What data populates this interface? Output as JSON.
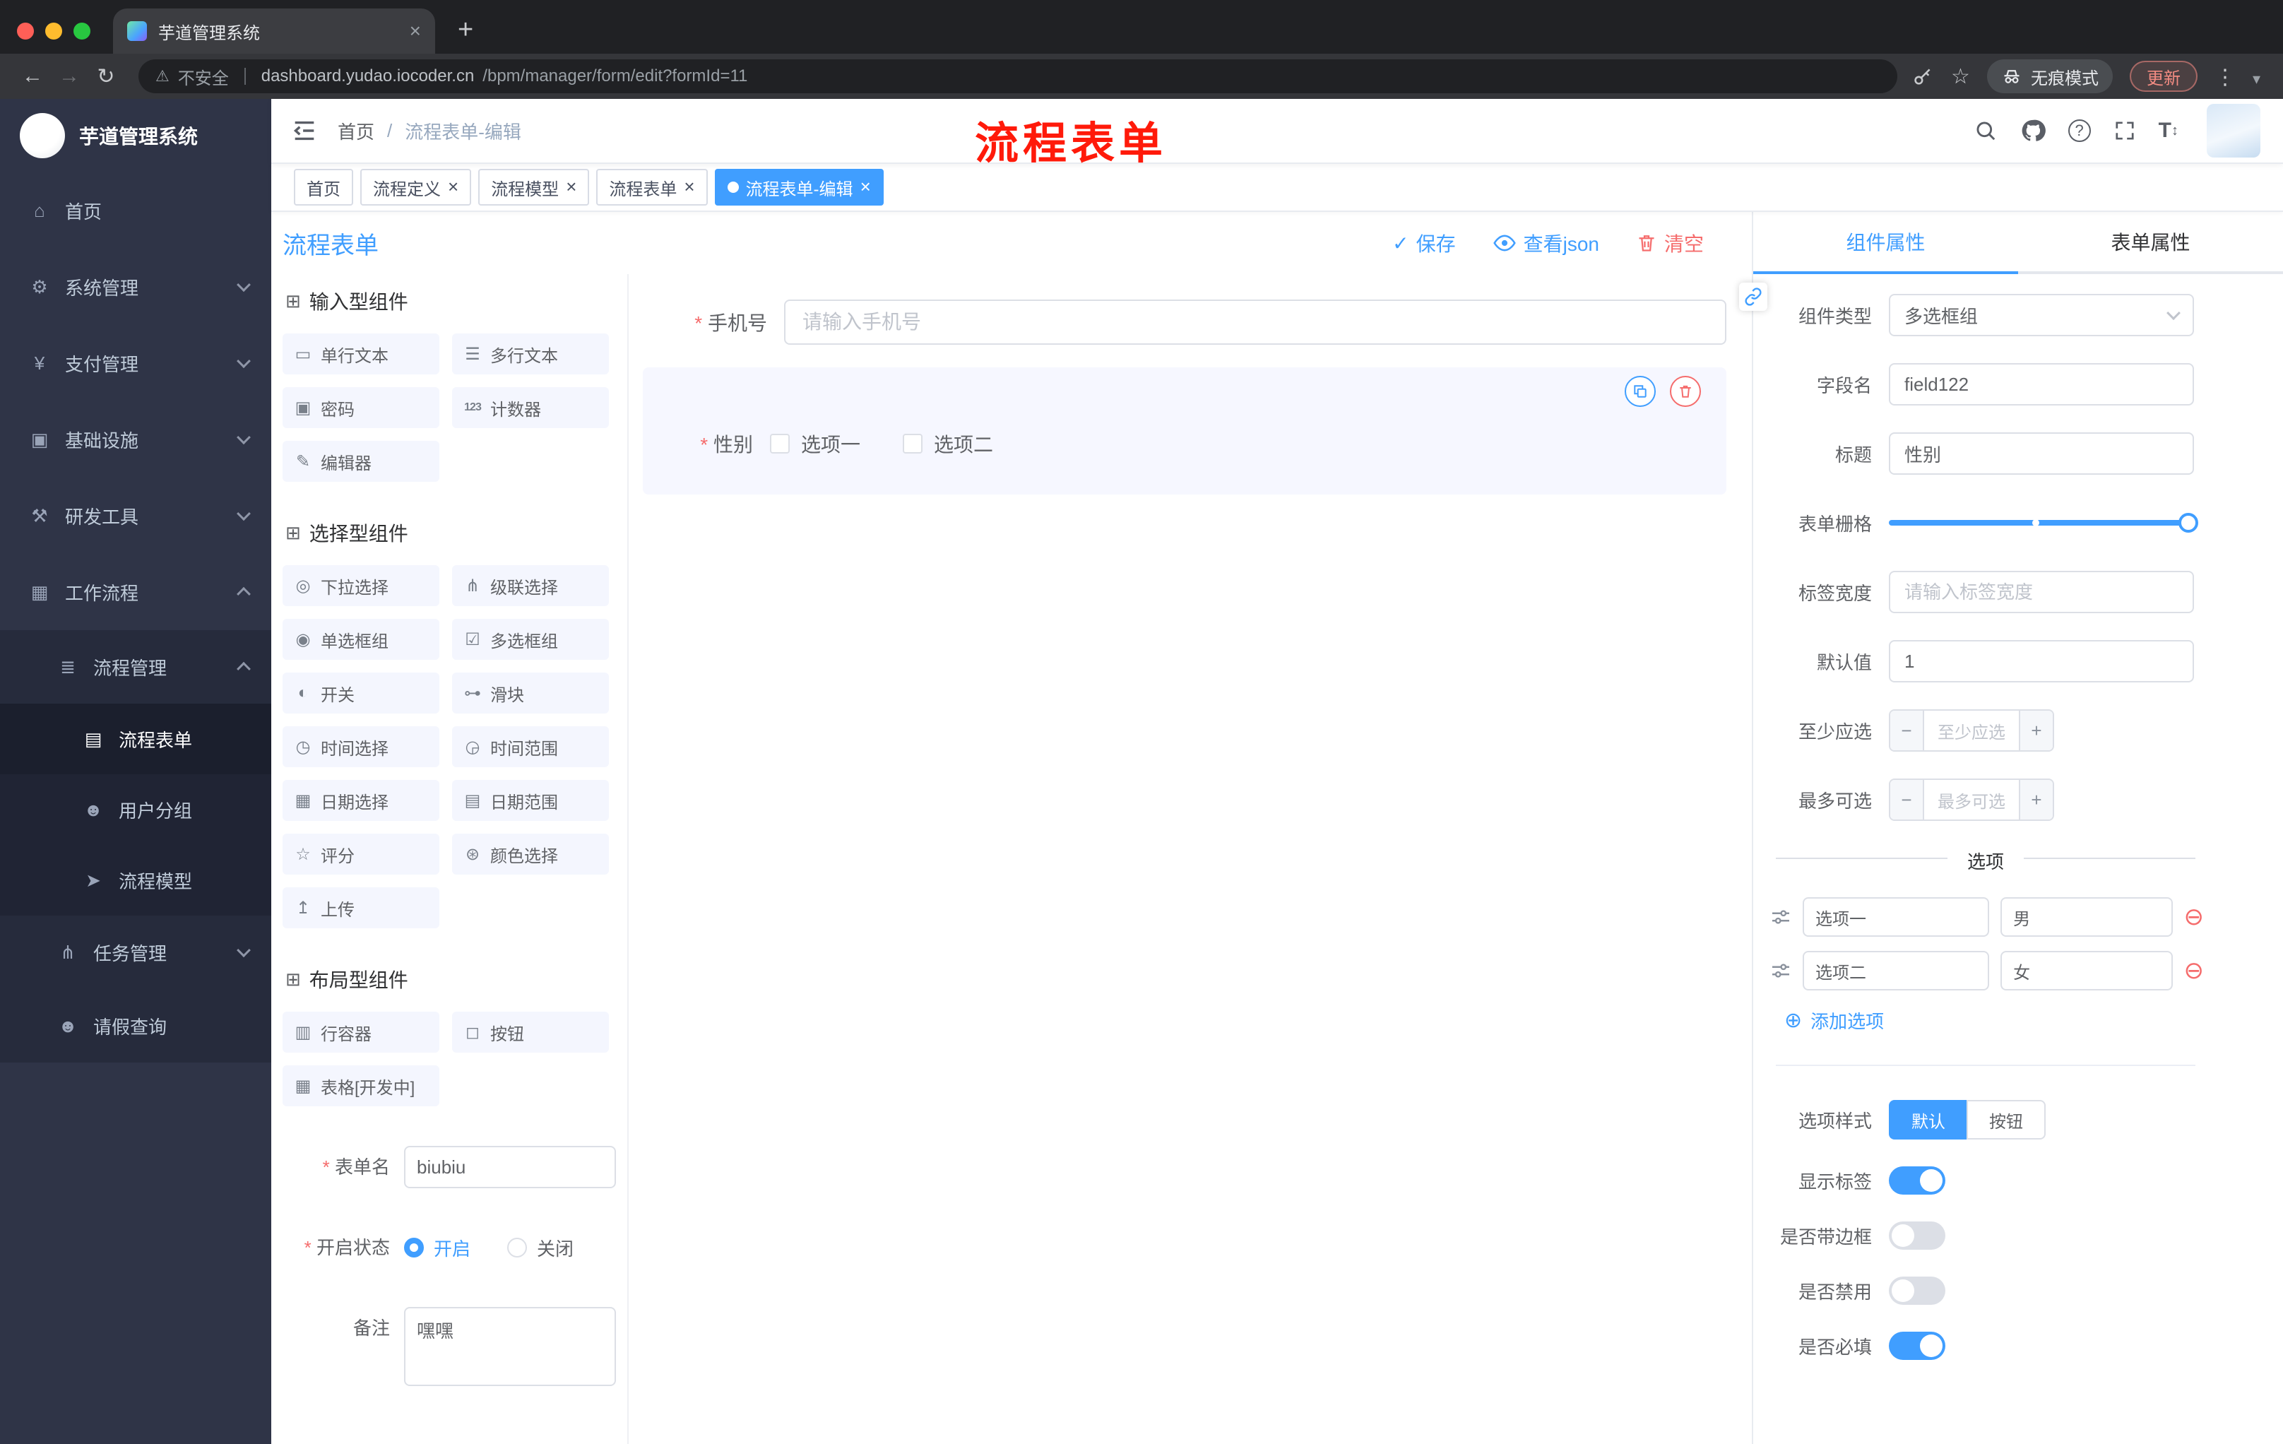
{
  "browser": {
    "tab_title": "芋道管理系统",
    "security_label": "不安全",
    "url_host": "dashboard.yudao.iocoder.cn",
    "url_path": "/bpm/manager/form/edit?formId=11",
    "incognito_label": "无痕模式",
    "update_label": "更新"
  },
  "annotation": "流程表单",
  "colors": {
    "accent": "#409EFF",
    "danger": "#F56C6C",
    "annotation": "#FF1A0A",
    "sidebar_bg": "#2F3447"
  },
  "sidebar": {
    "logo_title": "芋道管理系统",
    "items": [
      {
        "label": "首页",
        "icon": "⌂",
        "level": 1
      },
      {
        "label": "系统管理",
        "icon": "⚙",
        "level": 1,
        "expanded": false
      },
      {
        "label": "支付管理",
        "icon": "¥",
        "level": 1,
        "expanded": false
      },
      {
        "label": "基础设施",
        "icon": "▣",
        "level": 1,
        "expanded": false
      },
      {
        "label": "研发工具",
        "icon": "⚒",
        "level": 1,
        "expanded": false
      },
      {
        "label": "工作流程",
        "icon": "▦",
        "level": 1,
        "expanded": true
      },
      {
        "label": "流程管理",
        "icon": "≣",
        "level": 2,
        "expanded": true
      },
      {
        "label": "流程表单",
        "icon": "▤",
        "level": 3,
        "active": true
      },
      {
        "label": "用户分组",
        "icon": "☻",
        "level": 3
      },
      {
        "label": "流程模型",
        "icon": "➤",
        "level": 3
      },
      {
        "label": "任务管理",
        "icon": "⋔",
        "level": 2,
        "expanded": false
      },
      {
        "label": "请假查询",
        "icon": "☻",
        "level": 2
      }
    ]
  },
  "navbar": {
    "breadcrumb": {
      "home": "首页",
      "separator": "/",
      "current": "流程表单-编辑"
    }
  },
  "tags": [
    {
      "label": "首页",
      "closable": false,
      "active": false
    },
    {
      "label": "流程定义",
      "closable": true,
      "active": false
    },
    {
      "label": "流程模型",
      "closable": true,
      "active": false
    },
    {
      "label": "流程表单",
      "closable": true,
      "active": false
    },
    {
      "label": "流程表单-编辑",
      "closable": true,
      "active": true
    }
  ],
  "designer": {
    "title": "流程表单",
    "actions": {
      "save": "保存",
      "view_json": "查看json",
      "clear": "清空"
    },
    "palette": {
      "section_icon": "⊞",
      "groups": [
        {
          "title": "输入型组件",
          "labels": [
            "单行文本",
            "多行文本",
            "密码",
            "计数器",
            "编辑器"
          ],
          "icons": [
            "▭",
            "☰",
            "▣",
            "123",
            "✎"
          ]
        },
        {
          "title": "选择型组件",
          "labels": [
            "下拉选择",
            "级联选择",
            "单选框组",
            "多选框组",
            "开关",
            "滑块",
            "时间选择",
            "时间范围",
            "日期选择",
            "日期范围",
            "评分",
            "颜色选择",
            "上传"
          ],
          "icons": [
            "◎",
            "⋔",
            "◉",
            "☑",
            "◐",
            "⊶",
            "◷",
            "◶",
            "▦",
            "▤",
            "☆",
            "⊛",
            "↥"
          ]
        },
        {
          "title": "布局型组件",
          "labels": [
            "行容器",
            "按钮",
            "表格[开发中]"
          ],
          "icons": [
            "▥",
            "◻",
            "▦"
          ]
        }
      ]
    },
    "meta": {
      "name_label": "表单名",
      "name_value": "biubiu",
      "status_label": "开启状态",
      "status_on": "开启",
      "status_off": "关闭",
      "status_selected": "开启",
      "remark_label": "备注",
      "remark_value": "嘿嘿"
    },
    "canvas": {
      "phone": {
        "label": "手机号",
        "required": true,
        "placeholder": "请输入手机号"
      },
      "gender": {
        "label": "性别",
        "required": true,
        "option1": "选项一",
        "option2": "选项二",
        "selected": true
      }
    },
    "props": {
      "tab_component": "组件属性",
      "tab_form": "表单属性",
      "active_tab": "组件属性",
      "component_type_label": "组件类型",
      "component_type_value": "多选框组",
      "field_name_label": "字段名",
      "field_name_value": "field122",
      "title_label": "标题",
      "title_value": "性别",
      "grid_label": "表单栅格",
      "label_width_label": "标签宽度",
      "label_width_placeholder": "请输入标签宽度",
      "default_label": "默认值",
      "default_value": "1",
      "min_label": "至少应选",
      "min_placeholder": "至少应选",
      "max_label": "最多可选",
      "max_placeholder": "最多可选",
      "options_title": "选项",
      "options": [
        {
          "label": "选项一",
          "value": "男"
        },
        {
          "label": "选项二",
          "value": "女"
        }
      ],
      "add_option": "添加选项",
      "style_label": "选项样式",
      "style_default": "默认",
      "style_button": "按钮",
      "style_selected": "默认",
      "toggles": [
        {
          "label": "显示标签",
          "on": true
        },
        {
          "label": "是否带边框",
          "on": false
        },
        {
          "label": "是否禁用",
          "on": false
        },
        {
          "label": "是否必填",
          "on": true
        }
      ]
    }
  }
}
